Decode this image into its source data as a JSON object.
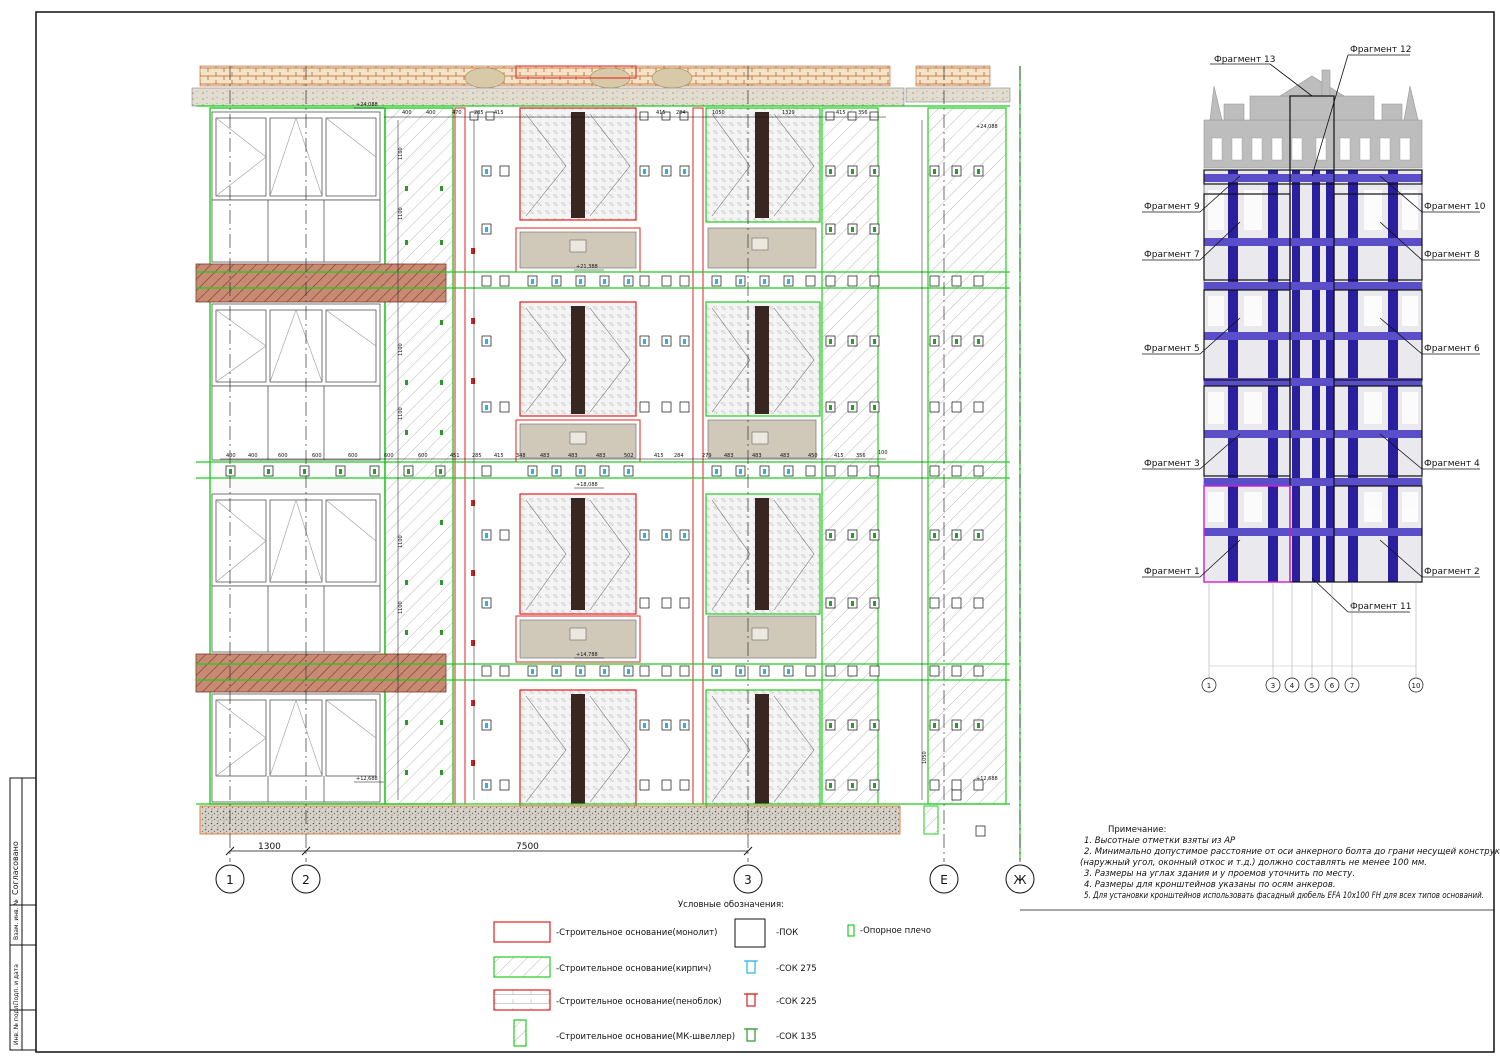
{
  "fragments": {
    "top": [
      "Фрагмент 13",
      "Фрагмент 12"
    ],
    "left": [
      "Фрагмент 9",
      "Фрагмент 7",
      "Фрагмент 5",
      "Фрагмент 3",
      "Фрагмент 1"
    ],
    "right": [
      "Фрагмент 10",
      "Фрагмент 8",
      "Фрагмент 6",
      "Фрагмент 4",
      "Фрагмент 2"
    ],
    "bottom": "Фрагмент 11"
  },
  "key_axes": [
    "1",
    "3",
    "4",
    "5",
    "6",
    "7",
    "10"
  ],
  "main_axes": [
    "1",
    "2",
    "3",
    "Е",
    "Ж"
  ],
  "dimensions": {
    "d1": "1300",
    "d2": "7500"
  },
  "elevations": [
    "+24,088",
    "+21,388",
    "+18,088",
    "+14,788",
    "+12,688",
    "+24,088",
    "+12,688"
  ],
  "dims_row": [
    "400",
    "400",
    "600",
    "600",
    "600",
    "600",
    "600",
    "600",
    "451",
    "285",
    "415",
    "348",
    "483",
    "483",
    "483",
    "502",
    "415",
    "284",
    "279",
    "483",
    "483",
    "483",
    "450",
    "415",
    "356",
    "100"
  ],
  "dims_top": [
    "400",
    "400",
    "470",
    "285",
    "415",
    "415",
    "284",
    "1050",
    "1329",
    "415",
    "356"
  ],
  "dims_vert": [
    "1100",
    "1100",
    "1100",
    "1100",
    "1100",
    "1100",
    "1050"
  ],
  "notes": {
    "title": "Примечание:",
    "items": [
      "1. Высотные отметки взяты из АР",
      "2. Минимально допустимое расстояние от оси анкерного болта до грани несущей конструкции",
      "(наружный угол, оконный откос и т.д.) должно составлять не менее 100 мм.",
      "3. Размеры на углах здания и у проемов уточнить по месту.",
      "4. Размеры для кронштейнов указаны по осям анкеров.",
      "5. Для установки кронштейнов использовать фасадный дюбель EFA 10х100 FH для всех типов оснований."
    ]
  },
  "legend": {
    "title": "Условные обозначения:",
    "items": [
      {
        "label": "-Строительное основание(монолит)",
        "kind": "monolith"
      },
      {
        "label": "-Строительное основание(кирпич)",
        "kind": "brick"
      },
      {
        "label": "-Строительное основание(пеноблок)",
        "kind": "foamblock"
      },
      {
        "label": "-Строительное основание(МК-швеллер)",
        "kind": "channel"
      },
      {
        "label": "-ПОК",
        "kind": "pok"
      },
      {
        "label": "-СОК 275",
        "kind": "sok275"
      },
      {
        "label": "-СОК 225",
        "kind": "sok225"
      },
      {
        "label": "-СОК 135",
        "kind": "sok135"
      },
      {
        "label": "-Опорное плечо",
        "kind": "support"
      }
    ]
  },
  "stamp": [
    "Согласовано",
    "Взам. инв. №",
    "Подп. и дата",
    "Инв. № подл."
  ],
  "colors": {
    "monolith": "#e02020",
    "brick": "#22cc22",
    "navy": "#2a1f9e",
    "sok275": "#2ab3e0",
    "sok225": "#d42020",
    "sok135": "#2a9a2a",
    "concrete": "#c9c2b2"
  }
}
